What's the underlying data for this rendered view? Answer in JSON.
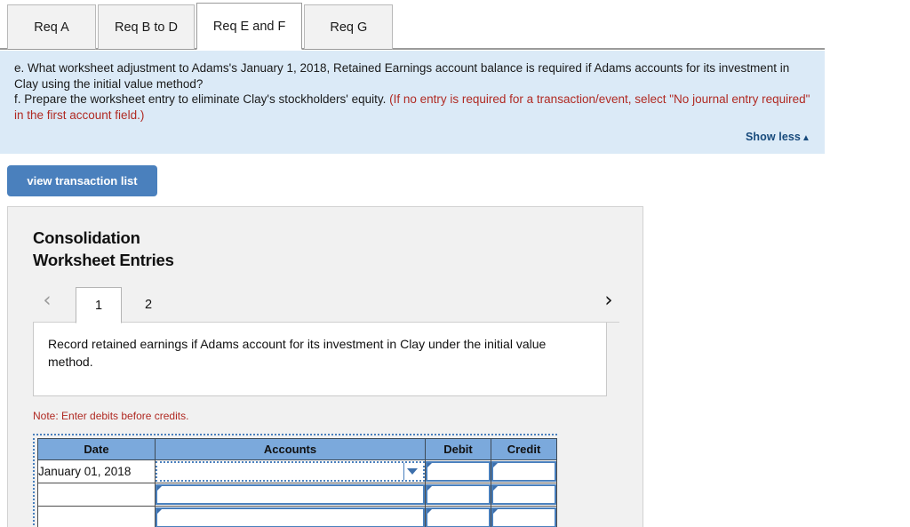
{
  "req_tabs": [
    {
      "label": "Req A",
      "active": false
    },
    {
      "label": "Req B to D",
      "active": false
    },
    {
      "label": "Req E and F",
      "active": true
    },
    {
      "label": "Req G",
      "active": false
    }
  ],
  "instructions": {
    "line_e": "e. What worksheet adjustment to Adams's January 1, 2018, Retained Earnings account balance is required if Adams accounts for its investment in Clay using the initial value method?",
    "line_f_black": "f. Prepare the worksheet entry to eliminate Clay's stockholders' equity. ",
    "line_f_red": "(If no entry is required for a transaction/event, select \"No journal entry required\" in the first account field.)",
    "show_less_label": "Show less",
    "show_less_caret": "▲",
    "panel_color": "#dbeaf7",
    "red_color": "#b02a23",
    "link_color": "#174a7c"
  },
  "toolbar": {
    "view_transaction_list_label": "view transaction list",
    "button_color": "#4a80bd"
  },
  "worksheet": {
    "title_line1": "Consolidation",
    "title_line2": "Worksheet Entries",
    "prev_icon": "‹",
    "next_icon": "›",
    "entry_tabs": [
      {
        "label": "1",
        "active": true
      },
      {
        "label": "2",
        "active": false
      }
    ],
    "description": "Record retained earnings if Adams account for its investment in Clay under the initial value method.",
    "note": "Note: Enter debits before credits.",
    "table": {
      "headers": [
        "Date",
        "Accounts",
        "Debit",
        "Credit"
      ],
      "rows": [
        {
          "date": "January 01, 2018",
          "account": "",
          "account_focused": true,
          "has_dropdown": true,
          "debit": "",
          "credit": ""
        },
        {
          "date": "",
          "account": "",
          "account_focused": false,
          "has_dropdown": false,
          "debit": "",
          "credit": ""
        },
        {
          "date": "",
          "account": "",
          "account_focused": false,
          "has_dropdown": false,
          "debit": "",
          "credit": ""
        }
      ],
      "header_color": "#7ba9dc",
      "cell_border_color": "#4a80bd"
    }
  }
}
